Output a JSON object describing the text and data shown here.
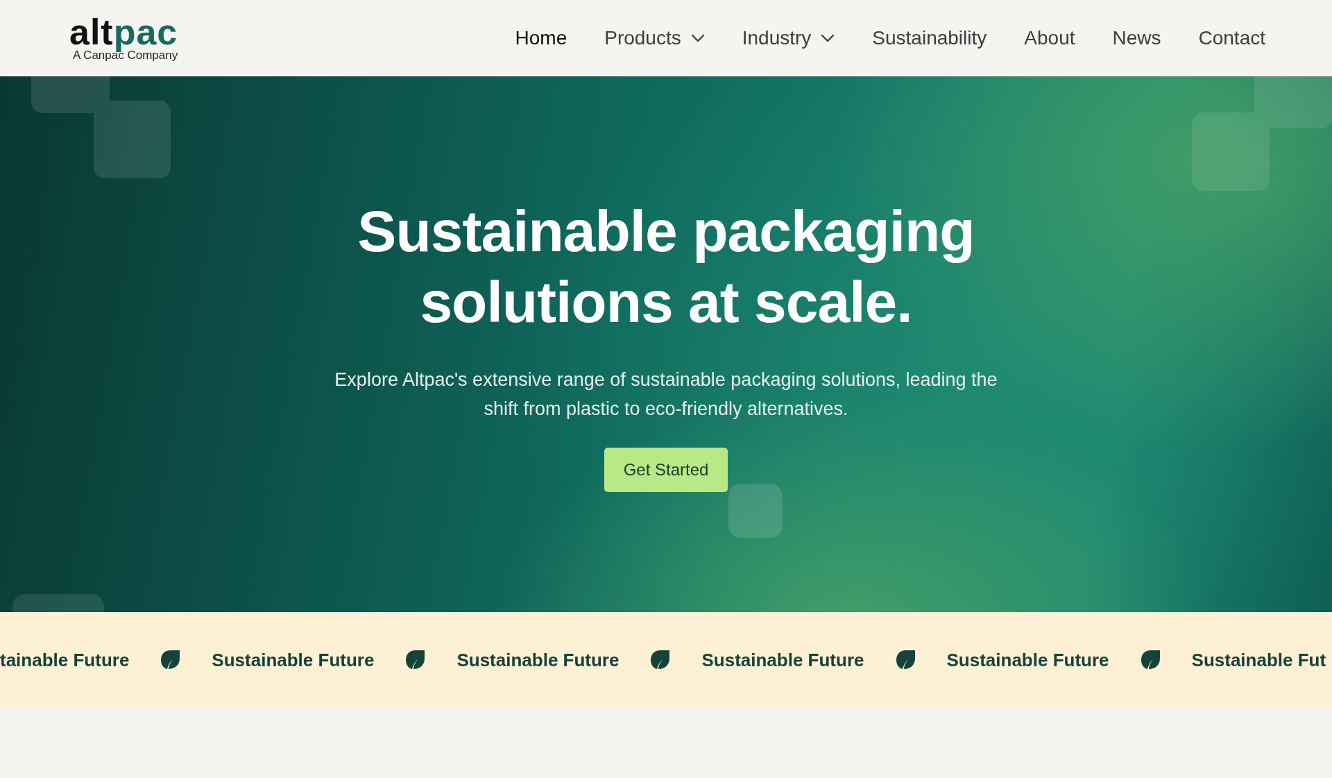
{
  "header": {
    "logo": {
      "wordmark_dark": "alt",
      "wordmark_accent": "pac",
      "tagline": "A Canpac Company"
    },
    "nav": [
      {
        "label": "Home",
        "selected": true,
        "dropdown": false
      },
      {
        "label": "Products",
        "selected": false,
        "dropdown": true
      },
      {
        "label": "Industry",
        "selected": false,
        "dropdown": true
      },
      {
        "label": "Sustainability",
        "selected": false,
        "dropdown": false
      },
      {
        "label": "About",
        "selected": false,
        "dropdown": false
      },
      {
        "label": "News",
        "selected": false,
        "dropdown": false
      },
      {
        "label": "Contact",
        "selected": false,
        "dropdown": false
      }
    ]
  },
  "hero": {
    "title": "Sustainable packaging solutions at scale.",
    "subtitle": "Explore Altpac's extensive range of sustainable packaging solutions, leading the shift from plastic to eco-friendly alternatives.",
    "button": "Get Started"
  },
  "ticker": {
    "items": [
      "tainable Future",
      "Sustainable Future",
      "Sustainable Future",
      "Sustainable Future",
      "Sustainable Future",
      "Sustainable Fut"
    ]
  }
}
